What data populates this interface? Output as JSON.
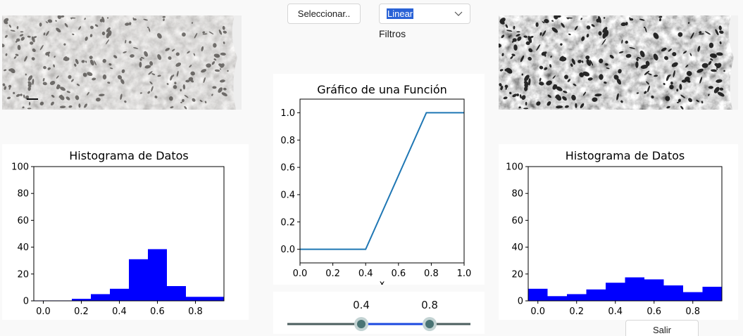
{
  "toolbar": {
    "select_label": "Seleccionar..",
    "filter_selected": "Linear",
    "filters_label": "Filtros",
    "exit_label": "Salir"
  },
  "charts": {
    "hist_left": {
      "type": "bar",
      "title": "Histograma de Datos",
      "bin_edges": [
        -0.05,
        0.05,
        0.15,
        0.25,
        0.35,
        0.45,
        0.55,
        0.65,
        0.75,
        0.85,
        0.95
      ],
      "values": [
        0.3,
        0.3,
        1.5,
        5,
        9,
        31,
        38.5,
        11,
        3,
        3
      ],
      "xlim": [
        -0.05,
        0.95
      ],
      "ylim": [
        0,
        100
      ],
      "xticks": [
        "0.0",
        "0.2",
        "0.4",
        "0.6",
        "0.8"
      ],
      "yticks": [
        "0",
        "20",
        "40",
        "60",
        "80",
        "100"
      ],
      "color": "#0000ff"
    },
    "func": {
      "type": "line",
      "title": "Gráfico de una Función",
      "xlabel": "x",
      "x": [
        0.0,
        0.4,
        0.77,
        1.0
      ],
      "y": [
        0.0,
        0.0,
        1.0,
        1.0
      ],
      "xlim": [
        0.0,
        1.0
      ],
      "ylim": [
        -0.1,
        1.1
      ],
      "xticks": [
        "0.0",
        "0.2",
        "0.4",
        "0.6",
        "0.8",
        "1.0"
      ],
      "yticks": [
        "0.0",
        "0.2",
        "0.4",
        "0.6",
        "0.8",
        "1.0"
      ],
      "color": "#1f77b4"
    },
    "hist_right": {
      "type": "bar",
      "title": "Histograma de Datos",
      "bin_edges": [
        -0.05,
        0.05,
        0.15,
        0.25,
        0.35,
        0.45,
        0.55,
        0.65,
        0.75,
        0.85,
        0.95
      ],
      "values": [
        9,
        3.5,
        5,
        8.5,
        13.5,
        17.5,
        16,
        11.5,
        6.5,
        10.5
      ],
      "xlim": [
        -0.05,
        0.95
      ],
      "ylim": [
        0,
        100
      ],
      "xticks": [
        "0.0",
        "0.2",
        "0.4",
        "0.6",
        "0.8"
      ],
      "yticks": [
        "0",
        "20",
        "40",
        "60",
        "80",
        "100"
      ],
      "color": "#0000ff"
    }
  },
  "slider": {
    "low_label": "0.4",
    "high_label": "0.8",
    "low": 0.4,
    "high": 0.8
  }
}
